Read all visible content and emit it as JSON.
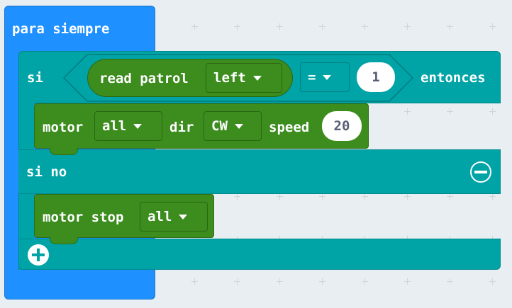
{
  "workspace": {
    "background": "#e9eef2"
  },
  "forever_block": {
    "label": "para siempre",
    "color": "#1e90ff"
  },
  "if_block": {
    "if_label": "si",
    "then_label": "entonces",
    "else_label": "si no",
    "color": "#00a4a6",
    "condition": {
      "left": {
        "label": "read patrol",
        "dropdown_value": "left"
      },
      "operator": "=",
      "right_value": "1"
    },
    "remove_else_icon": "minus-circle-icon",
    "add_else_icon": "plus-circle-icon"
  },
  "then_stmt": {
    "label": "motor",
    "motor_value": "all",
    "dir_label": "dir",
    "dir_value": "CW",
    "speed_label": "speed",
    "speed_value": "20",
    "color": "#3c8c1e"
  },
  "else_stmt": {
    "label": "motor stop",
    "motor_value": "all",
    "color": "#3c8c1e"
  }
}
